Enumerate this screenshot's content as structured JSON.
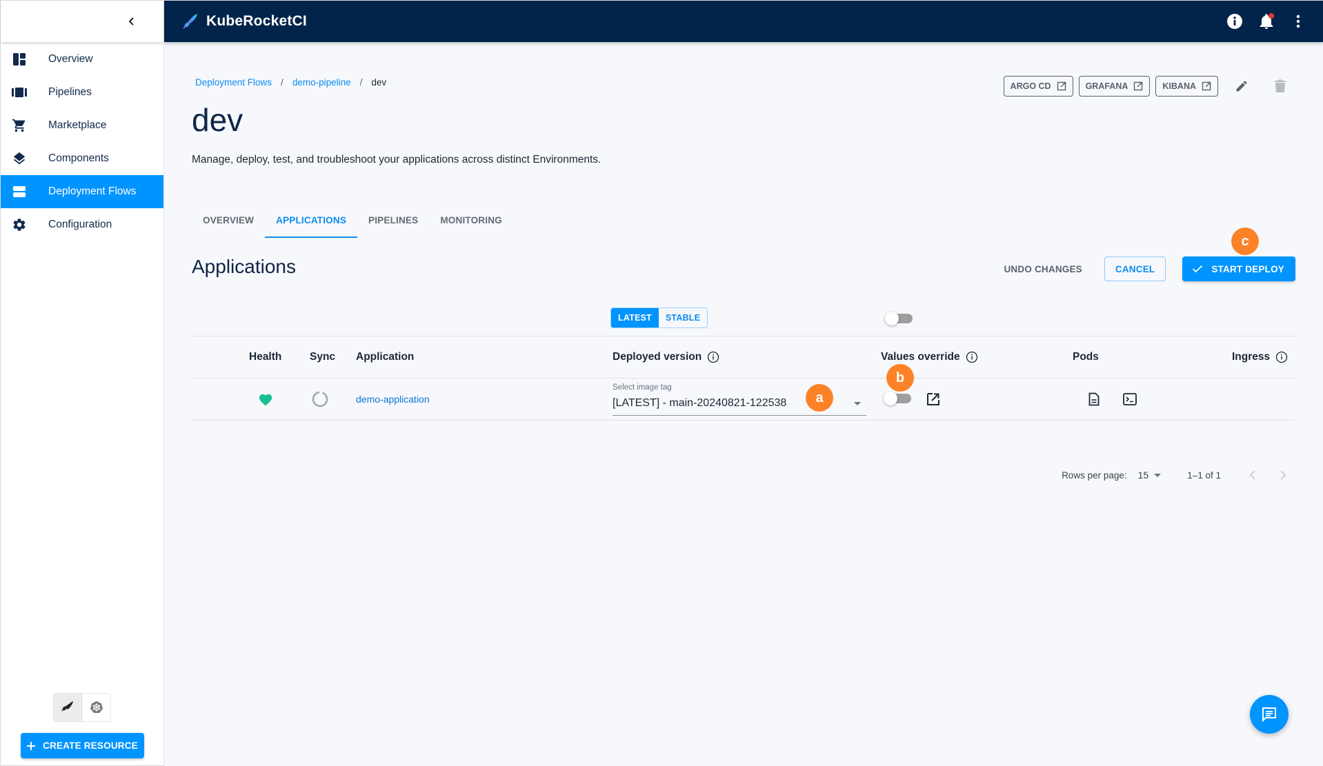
{
  "app": {
    "title": "KubeRocketCI"
  },
  "sidebar": {
    "items": [
      {
        "label": "Overview",
        "icon": "dashboard-icon",
        "active": false
      },
      {
        "label": "Pipelines",
        "icon": "pipelines-icon",
        "active": false
      },
      {
        "label": "Marketplace",
        "icon": "cart-icon",
        "active": false
      },
      {
        "label": "Components",
        "icon": "layers-icon",
        "active": false
      },
      {
        "label": "Deployment Flows",
        "icon": "deployment-flows-icon",
        "active": true
      },
      {
        "label": "Configuration",
        "icon": "gear-icon",
        "active": false
      }
    ],
    "mode_switch": [
      "krci-mode-icon",
      "kubernetes-mode-icon"
    ],
    "create_resource_label": "CREATE RESOURCE"
  },
  "topbar": {
    "icons": [
      "info-icon",
      "bell-icon",
      "more-vertical-icon"
    ],
    "notification_dot_color": "#e53935"
  },
  "breadcrumb": {
    "items": [
      "Deployment Flows",
      "demo-pipeline"
    ],
    "current": "dev",
    "separator": "/"
  },
  "page": {
    "title": "dev",
    "description": "Manage, deploy, test, and troubleshoot your applications across distinct Environments."
  },
  "header_links": [
    {
      "label": "ARGO CD"
    },
    {
      "label": "GRAFANA"
    },
    {
      "label": "KIBANA"
    }
  ],
  "tabs": [
    {
      "label": "OVERVIEW",
      "active": false
    },
    {
      "label": "APPLICATIONS",
      "active": true
    },
    {
      "label": "PIPELINES",
      "active": false
    },
    {
      "label": "MONITORING",
      "active": false
    }
  ],
  "applications": {
    "title": "Applications",
    "undo_label": "UNDO CHANGES",
    "cancel_label": "CANCEL",
    "start_deploy_label": "START DEPLOY",
    "version_toggle": {
      "options": [
        "LATEST",
        "STABLE"
      ],
      "selected": "LATEST"
    },
    "values_override_all": false,
    "columns": [
      "Health",
      "Sync",
      "Application",
      "Deployed version",
      "Values override",
      "Pods",
      "Ingress"
    ],
    "rows": [
      {
        "health": "healthy",
        "sync": "unknown",
        "application": "demo-application",
        "image_tag_label": "Select image tag",
        "image_tag_value": "[LATEST] - main-20240821-122538",
        "values_override": false
      }
    ],
    "pagination": {
      "rows_per_page_label": "Rows per page:",
      "rows_per_page": "15",
      "range": "1–1 of 1"
    }
  },
  "markers": {
    "a": "a",
    "b": "b",
    "c": "c"
  },
  "colors": {
    "accent": "#0094ff",
    "header_bg": "#02244a",
    "marker": "#fd8227",
    "healthy": "#18be94"
  }
}
